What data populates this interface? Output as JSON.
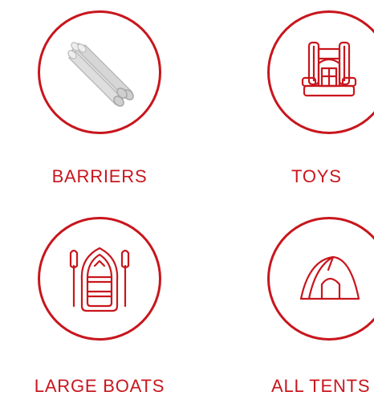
{
  "accent_color": "#c8161d",
  "categories": [
    {
      "label": "BARRIERS",
      "icon": "barriers-icon"
    },
    {
      "label": "TOYS",
      "icon": "bounce-house-icon"
    },
    {
      "label": "LARGE BOATS",
      "icon": "inflatable-boat-icon"
    },
    {
      "label": "ALL TENTS",
      "icon": "tent-icon"
    }
  ]
}
